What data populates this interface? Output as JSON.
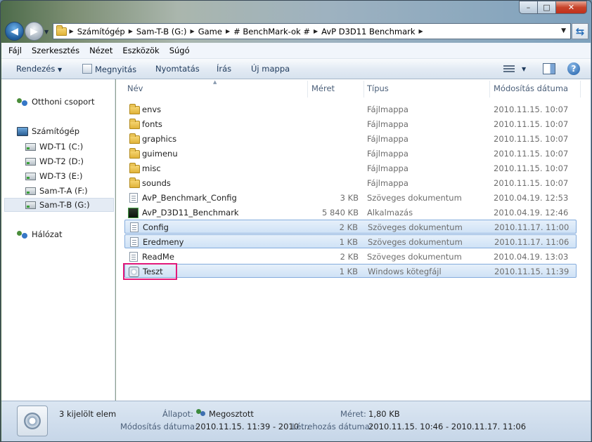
{
  "address": {
    "crumbs": [
      "Számítógép",
      "Sam-T-B (G:)",
      "Game",
      "# BenchMark-ok #",
      "AvP D3D11 Benchmark"
    ]
  },
  "menu": [
    "Fájl",
    "Szerkesztés",
    "Nézet",
    "Eszközök",
    "Súgó"
  ],
  "toolbar": {
    "organize": "Rendezés",
    "open": "Megnyitás",
    "print": "Nyomtatás",
    "burn": "Írás",
    "new_folder": "Új mappa"
  },
  "sidebar": {
    "homegroup": "Otthoni csoport",
    "computer": "Számítógép",
    "drives": [
      "WD-T1 (C:)",
      "WD-T2 (D:)",
      "WD-T3 (E:)",
      "Sam-T-A (F:)",
      "Sam-T-B (G:)"
    ],
    "network": "Hálózat"
  },
  "columns": {
    "name": "Név",
    "size": "Méret",
    "type": "Típus",
    "date": "Módosítás dátuma"
  },
  "files": [
    {
      "name": "envs",
      "size": "",
      "type": "Fájlmappa",
      "date": "2010.11.15. 10:07",
      "icon": "folder-icon"
    },
    {
      "name": "fonts",
      "size": "",
      "type": "Fájlmappa",
      "date": "2010.11.15. 10:07",
      "icon": "folder-icon"
    },
    {
      "name": "graphics",
      "size": "",
      "type": "Fájlmappa",
      "date": "2010.11.15. 10:07",
      "icon": "folder-icon"
    },
    {
      "name": "guimenu",
      "size": "",
      "type": "Fájlmappa",
      "date": "2010.11.15. 10:07",
      "icon": "folder-icon"
    },
    {
      "name": "misc",
      "size": "",
      "type": "Fájlmappa",
      "date": "2010.11.15. 10:07",
      "icon": "folder-icon"
    },
    {
      "name": "sounds",
      "size": "",
      "type": "Fájlmappa",
      "date": "2010.11.15. 10:07",
      "icon": "folder-icon"
    },
    {
      "name": "AvP_Benchmark_Config",
      "size": "3 KB",
      "type": "Szöveges dokumentum",
      "date": "2010.04.19. 12:53",
      "icon": "text-file-icon"
    },
    {
      "name": "AvP_D3D11_Benchmark",
      "size": "5 840 KB",
      "type": "Alkalmazás",
      "date": "2010.04.19. 12:46",
      "icon": "application-icon"
    },
    {
      "name": "Config",
      "size": "2 KB",
      "type": "Szöveges dokumentum",
      "date": "2010.11.17. 11:00",
      "icon": "text-file-icon",
      "selected": true
    },
    {
      "name": "Eredmeny",
      "size": "1 KB",
      "type": "Szöveges dokumentum",
      "date": "2010.11.17. 11:06",
      "icon": "text-file-icon",
      "selected": true
    },
    {
      "name": "ReadMe",
      "size": "2 KB",
      "type": "Szöveges dokumentum",
      "date": "2010.04.19. 13:03",
      "icon": "text-file-icon"
    },
    {
      "name": "Teszt",
      "size": "1 KB",
      "type": "Windows kötegfájl",
      "date": "2010.11.15. 11:39",
      "icon": "batch-file-icon",
      "selected": true
    }
  ],
  "status": {
    "selected_count": "3 kijelölt elem",
    "state_label": "Állapot:",
    "state_value": "Megosztott",
    "size_label": "Méret:",
    "size_value": "1,80 KB",
    "modified_label": "Módosítás dátuma:",
    "modified_value": "2010.11.15. 11:39 - 2010....",
    "created_label": "Létrehozás dátuma:",
    "created_value": "2010.11.15. 10:46 - 2010.11.17. 11:06"
  },
  "colors": {
    "selection_fill": "#cfe2f6",
    "selection_border": "#84acdd",
    "highlight_box": "#e3197a"
  }
}
